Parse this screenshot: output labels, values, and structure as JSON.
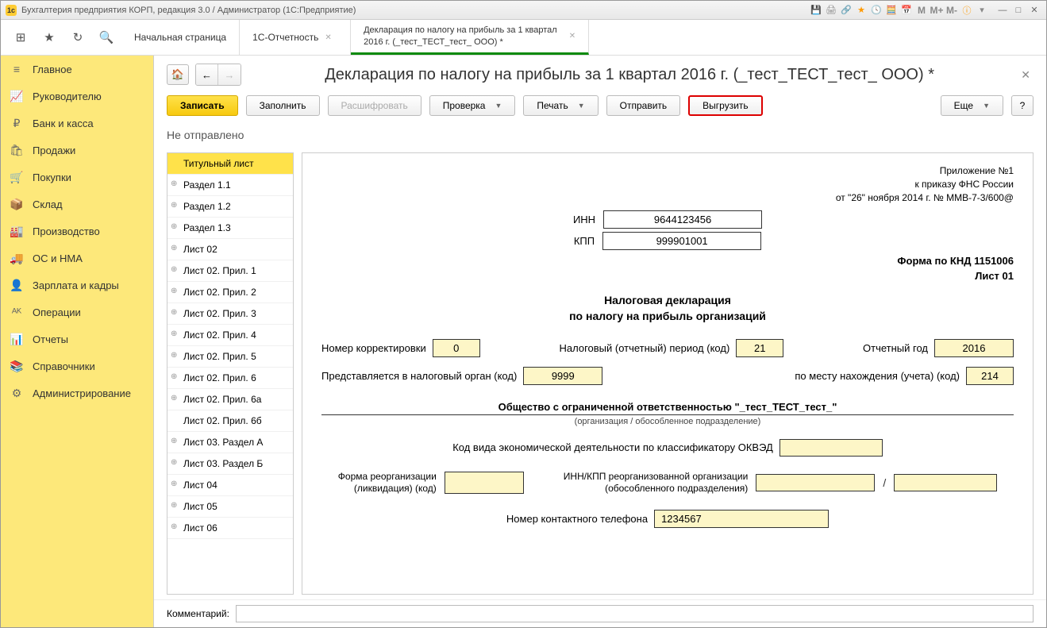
{
  "window": {
    "title": "Бухгалтерия предприятия КОРП, редакция 3.0 / Администратор  (1С:Предприятие)"
  },
  "toolbar_top": {
    "m": "M",
    "m_plus": "M+",
    "m_minus": "M-"
  },
  "tabs": {
    "start": "Начальная страница",
    "report": "1С-Отчетность",
    "decl": "Декларация по налогу на прибыль за 1 квартал 2016 г. (_тест_ТЕСТ_тест_ ООО) *"
  },
  "sidebar": {
    "items": [
      {
        "label": "Главное",
        "icon": "≡"
      },
      {
        "label": "Руководителю",
        "icon": "📈"
      },
      {
        "label": "Банк и касса",
        "icon": "₽"
      },
      {
        "label": "Продажи",
        "icon": "🛍"
      },
      {
        "label": "Покупки",
        "icon": "🛒"
      },
      {
        "label": "Склад",
        "icon": "📦"
      },
      {
        "label": "Производство",
        "icon": "🏭"
      },
      {
        "label": "ОС и НМА",
        "icon": "🚚"
      },
      {
        "label": "Зарплата и кадры",
        "icon": "👤"
      },
      {
        "label": "Операции",
        "icon": "ᴬᴷ"
      },
      {
        "label": "Отчеты",
        "icon": "📊"
      },
      {
        "label": "Справочники",
        "icon": "📚"
      },
      {
        "label": "Администрирование",
        "icon": "⚙"
      }
    ]
  },
  "page": {
    "title": "Декларация по налогу на прибыль за 1 квартал 2016 г. (_тест_ТЕСТ_тест_ ООО) *",
    "buttons": {
      "save": "Записать",
      "fill": "Заполнить",
      "decode": "Расшифровать",
      "check": "Проверка",
      "print": "Печать",
      "send": "Отправить",
      "export": "Выгрузить",
      "more": "Еще",
      "help": "?"
    },
    "status": "Не отправлено"
  },
  "tree": [
    "Титульный лист",
    "Раздел 1.1",
    "Раздел 1.2",
    "Раздел 1.3",
    "Лист 02",
    "Лист 02. Прил. 1",
    "Лист 02. Прил. 2",
    "Лист 02. Прил. 3",
    "Лист 02. Прил. 4",
    "Лист 02. Прил. 5",
    "Лист 02. Прил. 6",
    "Лист 02. Прил. 6а",
    "Лист 02. Прил. 6б",
    "Лист 03. Раздел А",
    "Лист 03. Раздел Б",
    "Лист 04",
    "Лист 05",
    "Лист 06"
  ],
  "form": {
    "appendix1": "Приложение №1",
    "appendix2": "к приказу ФНС России",
    "appendix3": "от \"26\" ноября 2014 г. № ММВ-7-3/600@",
    "inn_label": "ИНН",
    "inn": "9644123456",
    "kpp_label": "КПП",
    "kpp": "999901001",
    "knd": "Форма по КНД 1151006",
    "sheet": "Лист 01",
    "decl_title1": "Налоговая декларация",
    "decl_title2": "по налогу на прибыль организаций",
    "corr_label": "Номер корректировки",
    "corr": "0",
    "period_label": "Налоговый (отчетный) период (код)",
    "period": "21",
    "year_label": "Отчетный год",
    "year": "2016",
    "organ_label": "Представляется в налоговый орган (код)",
    "organ": "9999",
    "place_label": "по месту нахождения (учета) (код)",
    "place": "214",
    "org_name": "Общество с ограниченной ответственностью \"_тест_ТЕСТ_тест_\"",
    "org_sub": "(организация / обособленное подразделение)",
    "okved_label": "Код вида экономической деятельности по классификатору ОКВЭД",
    "reorg_label1": "Форма реорганизации",
    "reorg_label2": "(ликвидация) (код)",
    "reorg_inn1": "ИНН/КПП реорганизованной организации",
    "reorg_inn2": "(обособленного подразделения)",
    "phone_label": "Номер контактного телефона",
    "phone": "1234567"
  },
  "footer": {
    "comment_label": "Комментарий:"
  }
}
